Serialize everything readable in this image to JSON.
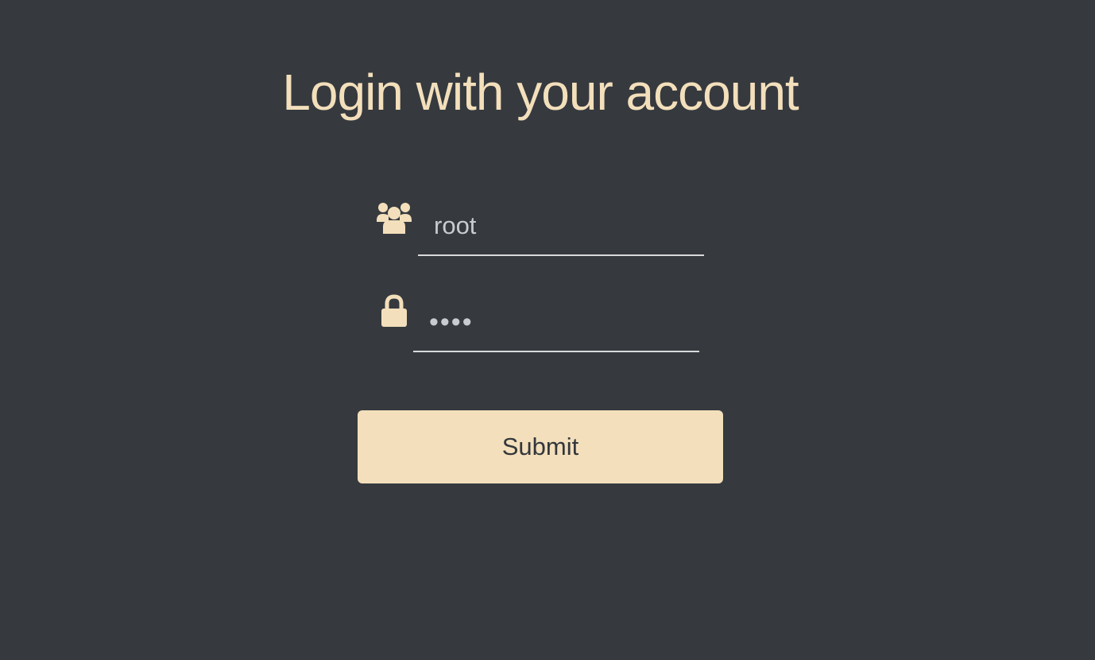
{
  "colors": {
    "background": "#363a3f",
    "accent": "#f3dfbb",
    "input_text": "#c8cbd0",
    "underline": "#d8d9db",
    "button_text": "#33373c"
  },
  "header": {
    "title": "Login with your account"
  },
  "form": {
    "username": {
      "icon": "users-icon",
      "value": "root"
    },
    "password": {
      "icon": "lock-icon",
      "value": "root"
    },
    "submit_label": "Submit"
  }
}
